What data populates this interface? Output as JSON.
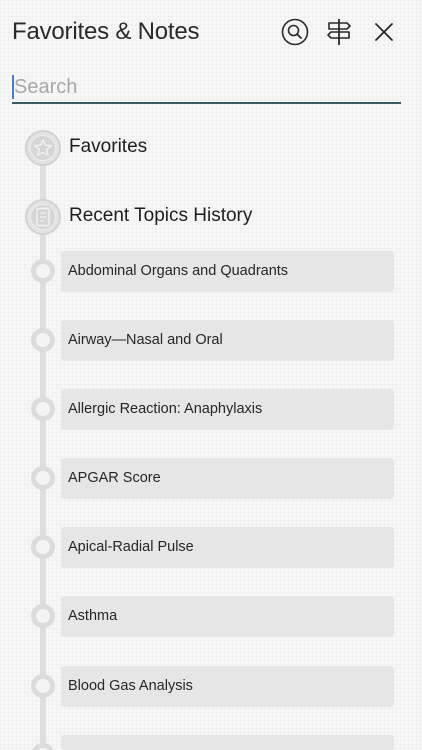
{
  "header": {
    "title": "Favorites & Notes",
    "search_button_icon": "search-circle-icon",
    "signpost_button_icon": "signpost-icon",
    "close_button_icon": "close-icon"
  },
  "search": {
    "placeholder": "Search",
    "value": ""
  },
  "sections": [
    {
      "label": "Favorites",
      "icon": "star-icon"
    },
    {
      "label": "Recent Topics History",
      "icon": "document-icon"
    }
  ],
  "history_items": [
    {
      "label": "Abdominal Organs and Quadrants"
    },
    {
      "label": "Airway—Nasal and Oral"
    },
    {
      "label": "Allergic Reaction: Anaphylaxis"
    },
    {
      "label": "APGAR Score"
    },
    {
      "label": "Apical-Radial Pulse"
    },
    {
      "label": "Asthma"
    },
    {
      "label": "Blood Gas Analysis"
    },
    {
      "label": ""
    }
  ],
  "colors": {
    "accent_underline": "#3d5960",
    "card_background": "#e6e6e6",
    "timeline": "#dedede"
  }
}
